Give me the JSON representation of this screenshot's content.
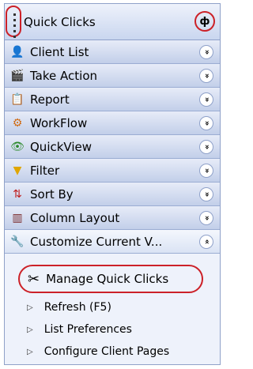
{
  "panel": {
    "title": "Quick Clicks",
    "pin_glyph": "ф",
    "rows": [
      {
        "label": "Client List",
        "icon": "person-icon",
        "glyph": "👤",
        "color": "#6b4a2a",
        "chevron": "»"
      },
      {
        "label": "Take Action",
        "icon": "clapperboard-icon",
        "glyph": "🎬",
        "color": "#333",
        "chevron": "»"
      },
      {
        "label": "Report",
        "icon": "clipboard-icon",
        "glyph": "📋",
        "color": "#6b4a2a",
        "chevron": "»"
      },
      {
        "label": "WorkFlow",
        "icon": "workflow-icon",
        "glyph": "⚙",
        "color": "#d06b14",
        "chevron": "»"
      },
      {
        "label": "QuickView",
        "icon": "eye-icon",
        "glyph": "👁",
        "color": "#2c8a2c",
        "chevron": "»"
      },
      {
        "label": "Filter",
        "icon": "funnel-icon",
        "glyph": "▼",
        "color": "#e0a600",
        "chevron": "»"
      },
      {
        "label": "Sort By",
        "icon": "sort-icon",
        "glyph": "⇅",
        "color": "#c02020",
        "chevron": "»"
      },
      {
        "label": "Column Layout",
        "icon": "columns-icon",
        "glyph": "▥",
        "color": "#7a2a2a",
        "chevron": "»"
      },
      {
        "label": "Customize Current V...",
        "icon": "wrench-icon",
        "glyph": "🔧",
        "color": "#444",
        "chevron": "«"
      }
    ]
  },
  "submenu": {
    "manage": {
      "label": "Manage Quick Clicks",
      "icon": "tools-icon",
      "glyph": "✂"
    },
    "items": [
      {
        "label": "Refresh (F5)",
        "arrow": "▷"
      },
      {
        "label": "List Preferences",
        "arrow": "▷"
      },
      {
        "label": "Configure Client Pages",
        "arrow": "▷"
      }
    ]
  }
}
